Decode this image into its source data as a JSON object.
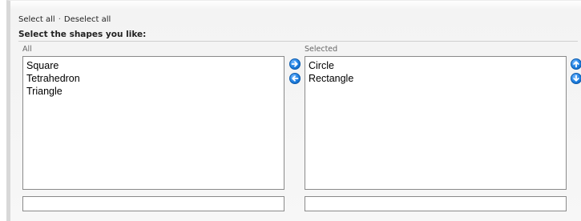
{
  "links": {
    "select_all": "Select all",
    "separator": "·",
    "deselect_all": "Deselect all"
  },
  "heading": "Select the shapes you like:",
  "available": {
    "label": "All",
    "items": [
      "Square",
      "Tetrahedron",
      "Triangle"
    ],
    "filter_value": ""
  },
  "selected": {
    "label": "Selected",
    "items": [
      "Circle",
      "Rectangle"
    ],
    "filter_value": ""
  },
  "buttons": {
    "add_icon": "arrow-right-icon",
    "remove_icon": "arrow-left-icon",
    "move_up_icon": "arrow-up-icon",
    "move_down_icon": "arrow-down-icon"
  },
  "colors": {
    "button_blue": "#1f7fe0",
    "panel_border": "#d8d8d8"
  }
}
